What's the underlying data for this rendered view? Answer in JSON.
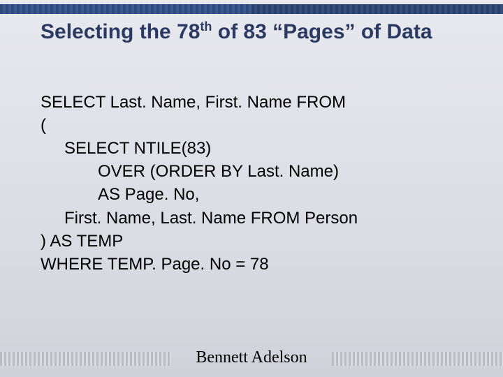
{
  "title": {
    "pre": "Selecting the 78",
    "sup": "th",
    "post": " of 83 “Pages” of Data"
  },
  "code": {
    "l1": "SELECT Last. Name, First. Name FROM",
    "l2": "(",
    "l3": "SELECT NTILE(83)",
    "l4": "OVER (ORDER BY Last. Name)",
    "l5": "AS Page. No,",
    "l6": "First. Name, Last. Name FROM Person",
    "l7": ") AS TEMP",
    "l8": "WHERE TEMP. Page. No = 78"
  },
  "footer": "Bennett Adelson"
}
